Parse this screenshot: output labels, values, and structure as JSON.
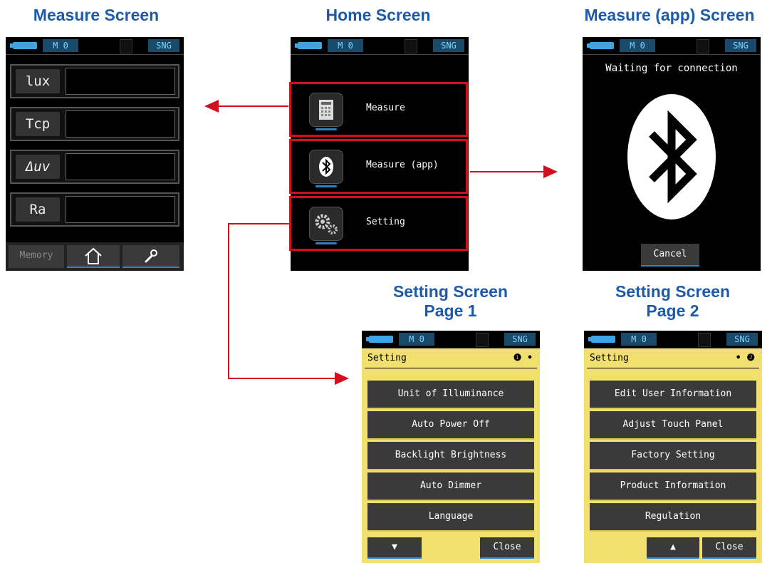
{
  "titles": {
    "measure": "Measure Screen",
    "home": "Home Screen",
    "measure_app": "Measure (app) Screen",
    "setting1_line1": "Setting Screen",
    "setting1_line2": "Page 1",
    "setting2_line1": "Setting Screen",
    "setting2_line2": "Page 2"
  },
  "statusbar": {
    "mode": "M 0",
    "sng": "SNG"
  },
  "measure_screen": {
    "rows": [
      {
        "label": "lux",
        "value": ""
      },
      {
        "label": "Tcp",
        "value": ""
      },
      {
        "label": "Δuv",
        "value": ""
      },
      {
        "label": "Ra",
        "value": ""
      }
    ],
    "nav": {
      "memory": "Memory",
      "home_icon": "home-icon",
      "wrench_icon": "wrench-icon"
    }
  },
  "home_screen": {
    "items": [
      {
        "label": "Measure",
        "icon": "measure-icon"
      },
      {
        "label": "Measure (app)",
        "icon": "bluetooth-icon"
      },
      {
        "label": "Setting",
        "icon": "gears-icon"
      }
    ]
  },
  "measure_app_screen": {
    "status_text": "Waiting for connection",
    "cancel_label": "Cancel",
    "icon": "bluetooth-icon"
  },
  "setting_page1": {
    "title": "Setting",
    "page_indicator": "❶ •",
    "items": [
      "Unit of Illuminance",
      "Auto Power Off",
      "Backlight Brightness",
      "Auto Dimmer",
      "Language"
    ],
    "down_label": "▼",
    "close_label": "Close"
  },
  "setting_page2": {
    "title": "Setting",
    "page_indicator": "• ❷",
    "items": [
      "Edit User Information",
      "Adjust Touch Panel",
      "Factory Setting",
      "Product Information",
      "Regulation"
    ],
    "up_label": "▲",
    "close_label": "Close"
  },
  "colors": {
    "title": "#1f5aa8",
    "arrow": "#d0101c",
    "setting_bg": "#f2e06e",
    "accent": "#2a84c8"
  }
}
